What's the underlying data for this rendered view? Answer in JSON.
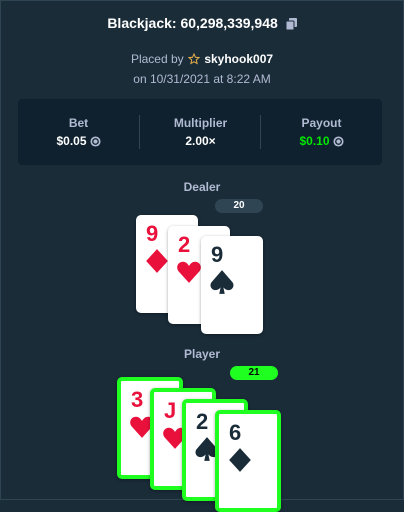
{
  "header": {
    "title": "Blackjack: 60,298,339,948"
  },
  "placed": {
    "prefix": "Placed by",
    "username": "skyhook007",
    "date": "on 10/31/2021 at 8:22 AM"
  },
  "stats": {
    "bet_label": "Bet",
    "bet_value": "$0.05",
    "multiplier_label": "Multiplier",
    "multiplier_value": "2.00×",
    "payout_label": "Payout",
    "payout_value": "$0.10"
  },
  "dealer": {
    "label": "Dealer",
    "score": "20",
    "cards": [
      {
        "rank": "9",
        "suit": "diamond",
        "color": "red"
      },
      {
        "rank": "2",
        "suit": "heart",
        "color": "red"
      },
      {
        "rank": "9",
        "suit": "spade",
        "color": "black"
      }
    ]
  },
  "player": {
    "label": "Player",
    "score": "21",
    "cards": [
      {
        "rank": "3",
        "suit": "heart",
        "color": "red"
      },
      {
        "rank": "J",
        "suit": "heart",
        "color": "red"
      },
      {
        "rank": "2",
        "suit": "spade",
        "color": "black"
      },
      {
        "rank": "6",
        "suit": "diamond",
        "color": "black"
      }
    ]
  },
  "colors": {
    "background": "#1a2c38",
    "panel": "#0f212e",
    "win_green": "#1fff20",
    "payout_green": "#00e701",
    "card_red": "#e9113c"
  }
}
